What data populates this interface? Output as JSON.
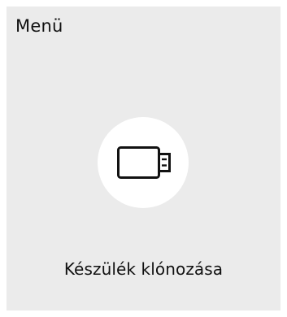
{
  "menu": {
    "title": "Menü"
  },
  "device_clone": {
    "label": "Készülék klónozása",
    "icon": "usb-drive-icon"
  },
  "colors": {
    "panel_background": "#ebebeb",
    "tile_background": "#ffffff",
    "text": "#111111"
  }
}
